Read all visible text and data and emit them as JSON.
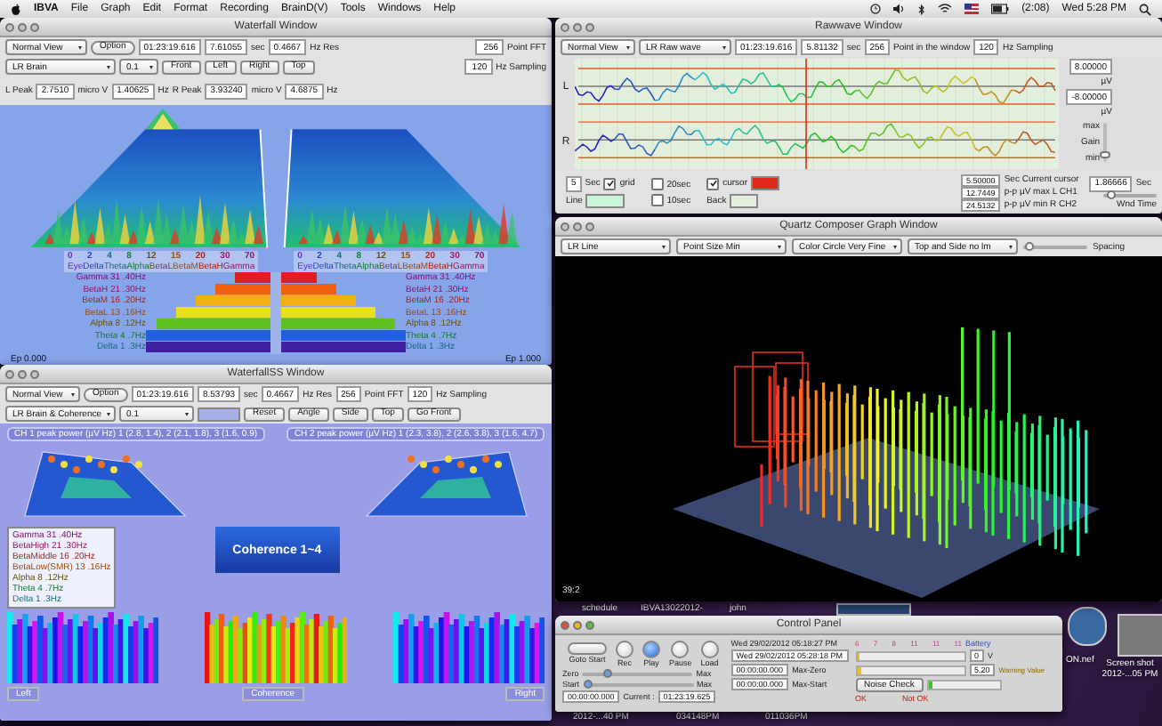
{
  "menu_bar": {
    "menus": [
      "IBVA",
      "File",
      "Graph",
      "Edit",
      "Format",
      "Recording",
      "BrainD(V)",
      "Tools",
      "Windows",
      "Help"
    ],
    "battery_time": "(2:08)",
    "clock": "Wed 5:28 PM"
  },
  "waterfall": {
    "title": "Waterfall Window",
    "view": "Normal View",
    "option": "Option",
    "time": "01:23:19.616",
    "seconds": "7.61055",
    "seconds_unit": "sec",
    "resolution": "0.4667",
    "resolution_unit": "Hz Res",
    "channel": "LR Brain",
    "step": "0.1",
    "buttons": [
      "Front",
      "Left",
      "Right",
      "Top"
    ],
    "peaks": [
      {
        "label": "L Peak",
        "amplitude": "2.7510",
        "amplitude_unit": "micro V",
        "frequency": "1.40625",
        "frequency_unit": "Hz"
      },
      {
        "label": "R Peak",
        "amplitude": "3.93240",
        "amplitude_unit": "micro V",
        "frequency": "4.6875",
        "frequency_unit": "Hz"
      }
    ],
    "fft": {
      "value": "256",
      "label": "Point FFT"
    },
    "sampling": {
      "value": "120",
      "label": "Hz Sampling"
    },
    "scales": [
      {
        "ticks": [
          "0",
          "2",
          "4",
          "8",
          "12",
          "15",
          "20",
          "30",
          "70"
        ],
        "names": [
          "Eye",
          "Delta",
          "Theta",
          "Alpha",
          "BetaL",
          "BetaM",
          "BetaH",
          "Gamma"
        ]
      },
      {
        "ticks": [
          "0",
          "2",
          "4",
          "8",
          "12",
          "15",
          "20",
          "30",
          "70"
        ],
        "names": [
          "Eye",
          "Delta",
          "Theta",
          "Alpha",
          "BetaL",
          "BetaM",
          "BetaH",
          "Gamma"
        ]
      }
    ],
    "bands": [
      {
        "left": "Gamma 31 .40Hz",
        "right": "Gamma 31 .40Hz"
      },
      {
        "left": "BetaH 21 .30Hz",
        "right": "BetaH 21 .30Hz"
      },
      {
        "left": "BetaM 16 .20Hz",
        "right": "BetaM 16 .20Hz"
      },
      {
        "left": "BetaL 13 .16Hz",
        "right": "BetaL 13 .16Hz"
      },
      {
        "left": "Alpha 8 .12Hz",
        "right": "Alpha 8 .12Hz"
      },
      {
        "left": "Theta 4 .7Hz",
        "right": "Theta 4 .7Hz"
      },
      {
        "left": "Delta 1 .3Hz",
        "right": "Delta 1 .3Hz"
      }
    ],
    "footer": [
      "Ep 0.000",
      "Ep 1.000"
    ]
  },
  "rawwave": {
    "title": "Rawwave Window",
    "view": "Normal View",
    "source": "LR Raw wave",
    "time": "01:23:19.616",
    "seconds": "5.81132",
    "seconds_unit": "sec",
    "points": "256",
    "points_label": "Point in the window",
    "sampling": "120",
    "sampling_label": "Hz Sampling",
    "channels": [
      "L",
      "R"
    ],
    "scale": [
      {
        "value": "8.00000",
        "unit": "µV"
      },
      {
        "value": "-8.00000",
        "unit": "µV"
      }
    ],
    "gain_labels": [
      "max",
      "Gain",
      "min"
    ],
    "gain": {
      "level": 0.1
    },
    "window_seconds": {
      "value": "5",
      "unit": "Sec"
    },
    "grid": {
      "label": "grid",
      "checked": true
    },
    "line": {
      "label": "Line",
      "color": "#c8f5d8"
    },
    "intervals": [
      {
        "label": "20sec",
        "checked": false
      },
      {
        "label": "10sec",
        "checked": false
      }
    ],
    "cursor": {
      "label": "cursor",
      "checked": true,
      "color": "#e02a1a"
    },
    "back": {
      "label": "Back",
      "color": "#e4eedc"
    },
    "readings": [
      {
        "value": "5.50000",
        "label": "Sec Current cursor"
      },
      {
        "value": "12.7449",
        "label": "p-p µV max L CH1"
      },
      {
        "value": "24.5132",
        "label": "p-p µV min R CH2"
      }
    ],
    "wnd_time": {
      "value": "1.86666",
      "unit": "Sec",
      "label": "Wnd Time",
      "level": 0.08
    }
  },
  "quartz": {
    "title": "Quartz Composer Graph Window",
    "selects": [
      "LR Line",
      "Point Size Min",
      "Color Circle Very Fine",
      "Top and Side no lm"
    ],
    "spacing": {
      "label": "Spacing",
      "level": 0.04
    },
    "frame": "39:2"
  },
  "waterfall_ss": {
    "title": "WaterfallSS Window",
    "view": "Normal View",
    "option": "Option",
    "time": "01:23:19.616",
    "seconds": "8.53793",
    "seconds_unit": "sec",
    "resolution": "0.4667",
    "resolution_unit": "Hz Res",
    "fft": {
      "value": "256",
      "label": "Point FFT"
    },
    "sampling": {
      "value": "120",
      "label": "Hz Sampling"
    },
    "channel": "LR Brain & Coherence",
    "step": "0.1",
    "buttons": [
      "Reset",
      "Angle",
      "Side",
      "Top",
      "Go Front"
    ],
    "peak_power": [
      "CH 1 peak power (µV Hz) 1 (2.8, 1.4), 2 (2.1, 1.8), 3 (1.6, 0.9)",
      "CH 2 peak power (µV Hz) 1 (2.3, 3.8), 2 (2.6, 3.8), 3 (1.6, 4.7)"
    ],
    "coherence_label": "Coherence 1~4",
    "legend": [
      "Gamma 31 .40Hz",
      "BetaHigh 21 .30Hz",
      "BetaMiddle 16 .20Hz",
      "BetaLow(SMR) 13 .16Hz",
      "Alpha 8 .12Hz",
      "Theta 4 .7Hz",
      "Delta 1 .3Hz"
    ],
    "panel_labels": [
      "Left",
      "Coherence",
      "Right"
    ]
  },
  "desktop_icons": [
    {
      "label": "schedule"
    },
    {
      "label": "IBVA13022012-"
    },
    {
      "label": "john"
    },
    {
      "label": "ON.nef"
    },
    {
      "label": "Screen shot 2012-...05 PM"
    },
    {
      "label": "2012-...40 PM"
    },
    {
      "label": "034148PM"
    },
    {
      "label": "011036PM"
    }
  ],
  "control_panel": {
    "title": "Control Panel",
    "transport": [
      {
        "label": "Goto Start",
        "kind": "wide",
        "selected": false
      },
      {
        "label": "Rec",
        "kind": "round",
        "selected": false
      },
      {
        "label": "Play",
        "kind": "round",
        "selected": true
      },
      {
        "label": "Pause",
        "kind": "round",
        "selected": false
      },
      {
        "label": "Load",
        "kind": "round",
        "selected": false
      }
    ],
    "sliders": [
      {
        "label": "Zero",
        "end": "Max",
        "level": 0.2
      },
      {
        "label": "Start",
        "end": "Max",
        "level": 0.0
      }
    ],
    "start_time": "00:00:00.000",
    "current_label": "Current :",
    "current": "01:23:19.625",
    "recorded": "Wed 29/02/2012 05:18:27 PM",
    "now": "Wed 29/02/2012 05:28:18 PM",
    "offsets": [
      {
        "value": "00:00:00.000",
        "label": "Max-Zero"
      },
      {
        "value": "00:00:00.000",
        "label": "Max-Start"
      }
    ],
    "meter_scale": [
      "6",
      "7",
      "8",
      "11",
      "11",
      "11"
    ],
    "meters": [
      {
        "level": 0.0
      },
      {
        "level": 0.04
      }
    ],
    "battery_label": "Battery",
    "battery_value": "0",
    "battery_unit": "V",
    "warning_value": "5.20",
    "warning_label": "Warning Value",
    "noise_check": "Noise Check",
    "noise": {
      "level": 0.06
    },
    "noise_ok": "OK",
    "noise_not_ok": "Not OK"
  }
}
